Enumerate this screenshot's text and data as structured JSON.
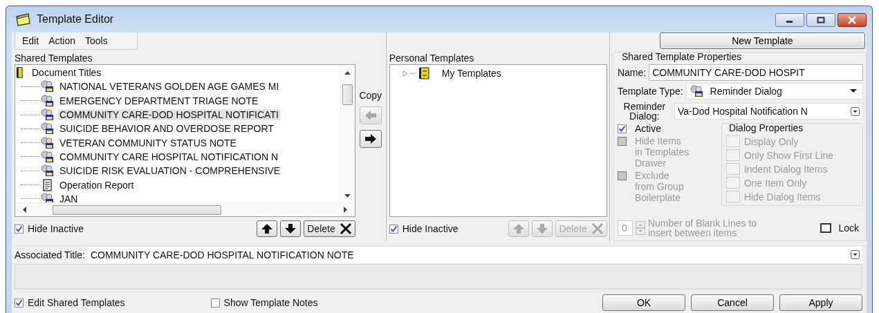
{
  "window": {
    "title": "Template Editor"
  },
  "menu": [
    "Edit",
    "Action",
    "Tools"
  ],
  "new_template_button": "New Template",
  "shared_templates": {
    "label": "Shared Templates",
    "tree": {
      "label": "Document Titles",
      "children": [
        {
          "label": "NATIONAL VETERANS GOLDEN AGE GAMES MI",
          "kind": "dialog",
          "selected": false
        },
        {
          "label": "EMERGENCY DEPARTMENT TRIAGE NOTE",
          "kind": "dialog",
          "selected": false
        },
        {
          "label": "COMMUNITY CARE-DOD HOSPITAL NOTIFICATI",
          "kind": "dialog",
          "selected": true
        },
        {
          "label": "SUICIDE BEHAVIOR AND OVERDOSE REPORT",
          "kind": "dialog",
          "selected": false
        },
        {
          "label": "VETERAN COMMUNITY STATUS NOTE",
          "kind": "dialog",
          "selected": false
        },
        {
          "label": "COMMUNITY CARE HOSPITAL NOTIFICATION N",
          "kind": "dialog",
          "selected": false
        },
        {
          "label": "SUICIDE RISK EVALUATION - COMPREHENSIVE",
          "kind": "dialog",
          "selected": false
        },
        {
          "label": "Operation Report",
          "kind": "note",
          "selected": false
        },
        {
          "label": "JAN",
          "kind": "dialog",
          "selected": false
        }
      ]
    },
    "hide_inactive": {
      "label": "Hide Inactive",
      "checked": true
    },
    "buttons_disabled": false,
    "delete_label": "Delete"
  },
  "copy": {
    "label": "Copy",
    "left_disabled": true,
    "right_disabled": false
  },
  "personal_templates": {
    "label": "Personal Templates",
    "tree": [
      {
        "label": "My Templates",
        "expanded": false
      }
    ],
    "hide_inactive": {
      "label": "Hide Inactive",
      "checked": true
    },
    "buttons_disabled": true,
    "delete_label": "Delete"
  },
  "properties": {
    "title": "Shared Template Properties",
    "name_label": "Name:",
    "name_value": "COMMUNITY CARE-DOD HOSPIT",
    "type_label": "Template Type:",
    "type_value": "Reminder Dialog",
    "dialog_label": "Reminder Dialog:",
    "dialog_value": "Va-Dod Hospital Notification N",
    "options": [
      {
        "label": "Active",
        "checked": true,
        "disabled": false
      },
      {
        "label": "Hide Items in Templates Drawer",
        "checked": false,
        "disabled": true
      },
      {
        "label": "Exclude from Group Boilerplate",
        "checked": false,
        "disabled": true
      }
    ],
    "dialog_properties": {
      "title": "Dialog Properties",
      "items": [
        {
          "label": "Display Only",
          "checked": false,
          "disabled": true
        },
        {
          "label": "Only Show First Line",
          "checked": false,
          "disabled": true
        },
        {
          "label": "Indent Dialog Items",
          "checked": false,
          "disabled": true
        },
        {
          "label": "One Item Only",
          "checked": false,
          "disabled": true
        },
        {
          "label": "Hide Dialog Items",
          "checked": false,
          "disabled": true
        }
      ]
    },
    "blank_lines": {
      "value": "0",
      "label": "Number of Blank Lines to insert between items",
      "disabled": true
    },
    "lock": {
      "label": "Lock",
      "checked": false
    }
  },
  "associated_title": {
    "label": "Associated Title:",
    "value": "COMMUNITY CARE-DOD HOSPITAL NOTIFICATION NOTE"
  },
  "footer": {
    "checkboxes": [
      {
        "label": "Edit Shared Templates",
        "checked": true
      },
      {
        "label": "Show Template Notes",
        "checked": false
      }
    ],
    "buttons": [
      "OK",
      "Cancel",
      "Apply"
    ]
  }
}
